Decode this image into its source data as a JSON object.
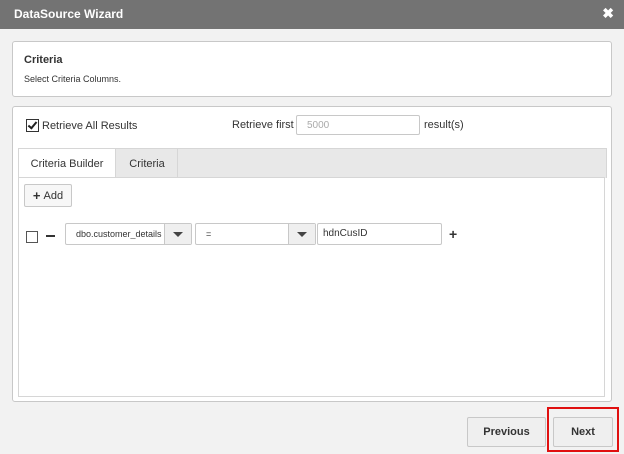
{
  "window": {
    "title": "DataSource Wizard",
    "close_glyph": "✖"
  },
  "header": {
    "title": "Criteria",
    "subtitle": "Select Criteria Columns."
  },
  "options": {
    "retrieve_all_label": "Retrieve All Results",
    "retrieve_all_checked": true,
    "retrieve_first_label": "Retrieve first",
    "retrieve_first_placeholder": "5000",
    "results_suffix": "result(s)"
  },
  "tabs": [
    {
      "label": "Criteria Builder",
      "active": true
    },
    {
      "label": "Criteria",
      "active": false
    }
  ],
  "builder": {
    "add_label": "Add",
    "add_icon": "+",
    "row": {
      "checked": false,
      "field": "dbo.customer_details",
      "operator": "=",
      "value": "hdnCusID",
      "add_row_icon": "+"
    }
  },
  "footer": {
    "previous_label": "Previous",
    "next_label": "Next"
  },
  "colors": {
    "titlebar": "#737373",
    "highlight": "#e01010"
  }
}
